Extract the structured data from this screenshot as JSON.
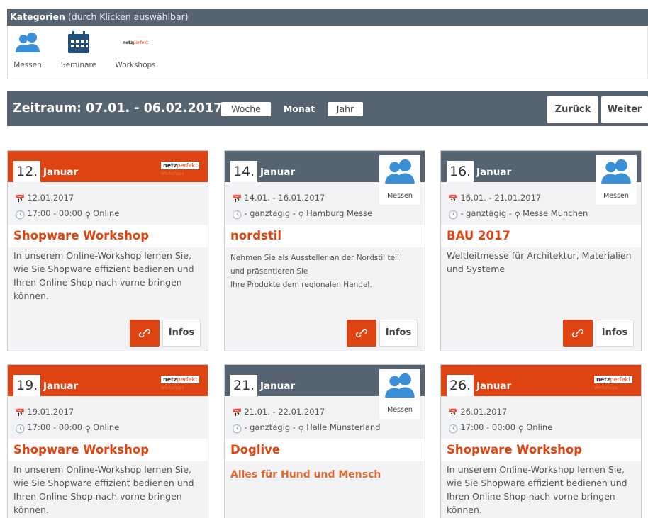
{
  "categories": {
    "header_bold": "Kategorien",
    "header_light": "(durch Klicken auswählbar)",
    "items": [
      {
        "label": "Messen",
        "icon": "people-icon"
      },
      {
        "label": "Seminare",
        "icon": "calendar-icon"
      },
      {
        "label": "Workshops",
        "icon": "netzperfekt-logo"
      }
    ]
  },
  "period": {
    "title": "Zeitraum: 07.01. - 06.02.2017",
    "views": [
      "Woche",
      "Monat",
      "Jahr"
    ],
    "active_view": "Monat",
    "back_label": "Zurück",
    "next_label": "Weiter"
  },
  "logo": {
    "brand_a": "netz",
    "brand_b": "perfekt"
  },
  "colors": {
    "accent": "#dd4411",
    "slate": "#566472"
  },
  "events": [
    {
      "day": "12.",
      "month": "Januar",
      "date": "12.01.2017",
      "time": "17:00 - 00:00",
      "location": "Online",
      "title": "Shopware Workshop",
      "category": "Workshops",
      "description": "In unserem Online-Workshop lernen Sie, wie Sie Shopware effizient bedienen und Ihren Online Shop nach vorne bringen können.",
      "infos_label": "Infos"
    },
    {
      "day": "14.",
      "month": "Januar",
      "date": "14.01. - 16.01.2017",
      "time": "- ganztägig -",
      "location": "Hamburg Messe",
      "title": "nordstil",
      "category": "Messen",
      "category_label": "Messen",
      "description_lines": [
        "Nehmen Sie als Aussteller an der Nordstil teil",
        "und präsentieren Sie",
        "Ihre Produkte dem regionalen Handel."
      ],
      "infos_label": "Infos"
    },
    {
      "day": "16.",
      "month": "Januar",
      "date": "16.01. - 21.01.2017",
      "time": "- ganztägig -",
      "location": "Messe München",
      "title": "BAU 2017",
      "category": "Messen",
      "category_label": "Messen",
      "description": "Weltleitmesse für Architektur, Materialien und Systeme",
      "infos_label": "Infos"
    },
    {
      "day": "19.",
      "month": "Januar",
      "date": "19.01.2017",
      "time": "17:00 - 00:00",
      "location": "Online",
      "title": "Shopware Workshop",
      "category": "Workshops",
      "description": "In unserem Online-Workshop lernen Sie, wie Sie Shopware effizient bedienen und Ihren Online Shop nach vorne bringen können."
    },
    {
      "day": "21.",
      "month": "Januar",
      "date": "21.01. - 22.01.2017",
      "time": "- ganztägig -",
      "location": "Halle Münsterland",
      "title": "Doglive",
      "category": "Messen",
      "category_label": "Messen",
      "description": "Alles für Hund und Mensch"
    },
    {
      "day": "26.",
      "month": "Januar",
      "date": "26.01.2017",
      "time": "17:00 - 00:00",
      "location": "Online",
      "title": "Shopware Workshop",
      "category": "Workshops",
      "description": "In unserem Online-Workshop lernen Sie, wie Sie Shopware effizient bedienen und Ihren Online Shop nach vorne bringen können."
    }
  ]
}
